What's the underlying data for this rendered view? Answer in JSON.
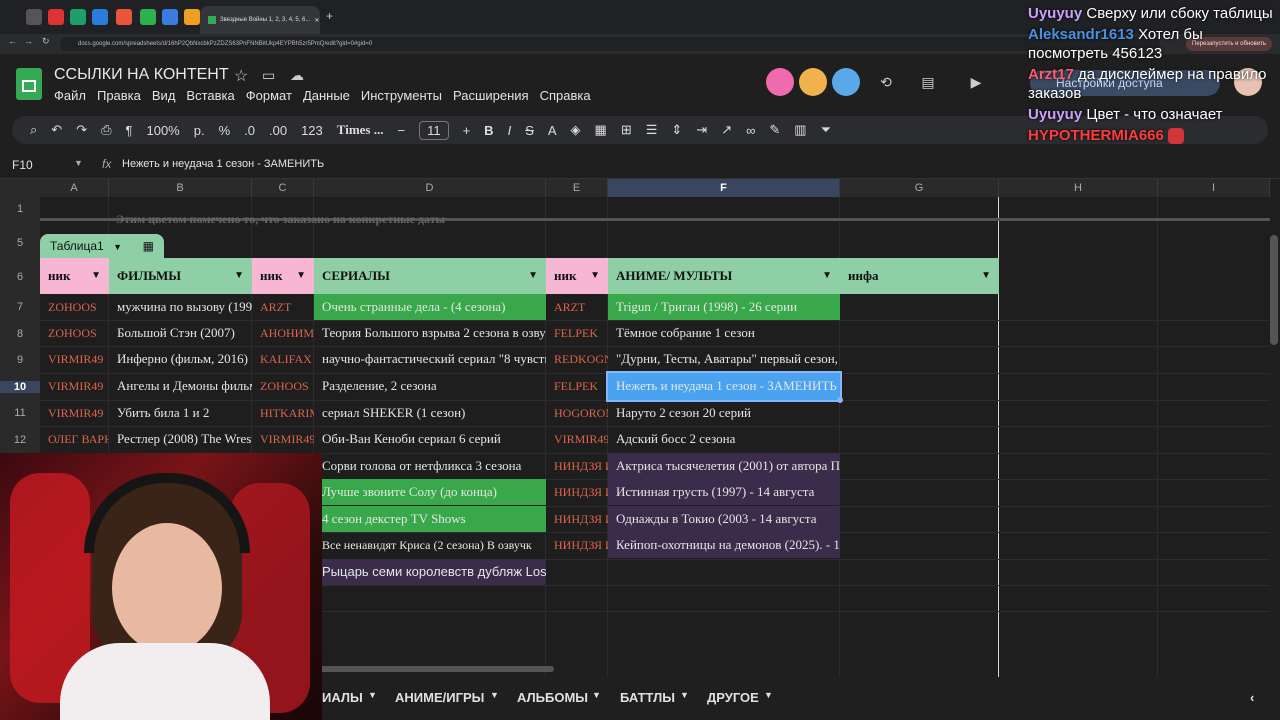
{
  "browser": {
    "active_tab_title": "Звездные Войны 1, 2, 3, 4, 5, 6...",
    "url": "docs.google.com/spreadsheets/d/16hP2QbNxcbkPzZDZS63PnFNNBitUkp4EYPBh5zr5PmQ/edit?gid=0#gid=0",
    "restart_label": "Перезапустить и обновить"
  },
  "doc": {
    "title": "ССЫЛКИ НА КОНТЕНТ",
    "menu": [
      "Файл",
      "Правка",
      "Вид",
      "Вставка",
      "Формат",
      "Данные",
      "Инструменты",
      "Расширения",
      "Справка"
    ],
    "access_button": "Настройки доступа"
  },
  "toolbar": {
    "zoom": "100%",
    "currency": "р.",
    "percent": "%",
    "dec_less": ".0",
    "dec_more": ".00",
    "format_123": "123",
    "font": "Times ...",
    "font_size": "11",
    "bold": "B",
    "italic": "I",
    "strike": "S",
    "text_color": "A"
  },
  "formula_bar": {
    "cell_ref": "F10",
    "fx": "fx",
    "content": "Нежеть и неудача 1 сезон - ЗАМЕНИТЬ"
  },
  "grid": {
    "columns": [
      "A",
      "B",
      "C",
      "D",
      "E",
      "F",
      "G",
      "H",
      "I"
    ],
    "rows": [
      "1",
      "5",
      "6",
      "7",
      "8",
      "9",
      "10",
      "11",
      "12"
    ],
    "note_row": "Этим цветом помечено то, что заказано на конкретные даты",
    "table_name": "Таблица1",
    "headers": {
      "nick1": "ник",
      "films": "ФИЛЬМЫ",
      "nick2": "ник",
      "series": "СЕРИАЛЫ",
      "nick3": "ник",
      "anime": "АНИМЕ/ МУЛЬТЫ",
      "info": "инфа"
    },
    "col_a": [
      "ZOHOOS",
      "ZOHOOS",
      "VIRMIR49",
      "VIRMIR49",
      "VIRMIR49",
      "ОЛЕГ ВАРНАВСКИ"
    ],
    "col_b": [
      "мужчина по вызову (1999",
      "Большой Стэн (2007)",
      "Инферно (фильм, 2016)",
      "Ангелы и Демоны фильм",
      "Убить била 1 и 2",
      "Рестлер (2008) The Wrest"
    ],
    "col_c": [
      "ARZT",
      "АНОНИМ",
      "KALIFAX",
      "ZOHOOS",
      "HITKARIM",
      "VIRMIR49"
    ],
    "col_d": [
      "Очень странные дела - (4 сезона)",
      "Теория Большого взрыва 2 сезона в озвуч",
      "научно-фантастический сериал \"8 чувств",
      "Разделение, 2 сезона",
      "сериал SHEKER (1 сезон)",
      "Оби-Ван Кеноби  сериал  6 серий",
      "Сорви голова от нетфликса 3 сезона",
      "Лучше звоните Солу (до конца)",
      "4 сезон декстер TV Shows",
      "Все ненавидят Криса (2 сезона) В озвучк",
      "Рыцарь семи королевств дубляж Lostfi"
    ],
    "col_e": [
      "ARZT",
      "FELPEK",
      "REDKOGNAR",
      "FELPEK",
      "HOGOROMO",
      "VIRMIR49",
      "НИНДЗЯ ИЗ А",
      "НИНДЗЯ ИЗ А",
      "НИНДЗЯ ИЗ А",
      "НИНДЗЯ ИЗ А"
    ],
    "col_f": [
      "Trigun / Триган (1998) - 26 серии",
      "Тёмное собрание 1 сезон",
      "\"Дурни, Тесты, Аватары\" первый сезон, т",
      "Нежеть и неудача 1 сезон - ЗАМЕНИТЬ",
      "Наруто 2 сезон 20 серий",
      "Адский босс 2 сезона",
      "Актриса тысячелетия (2001) от автора Па",
      "Истинная грусть (1997) - 14 августа",
      "Однажды в Токио (2003 - 14 августа",
      "Кейпоп-охотницы на демонов (2025). - 15"
    ]
  },
  "sheet_tabs": [
    "ИАЛЫ",
    "АНИМЕ/ИГРЫ",
    "АЛЬБОМЫ",
    "БАТТЛЫ",
    "ДРУГОЕ"
  ],
  "chat": [
    {
      "name": "Uyuyuy",
      "text": "Сверху или сбоку таблицы",
      "color": "#c9a0ff"
    },
    {
      "name": "Aleksandr1613",
      "text": "Хотел бы посмотреть 456123",
      "color": "#4a90e2"
    },
    {
      "name": "Arzt17",
      "text": "да дисклеймер на правило заказов",
      "color": "#ff5a6e"
    },
    {
      "name": "Uyuyuy",
      "text": "Цвет - что означает",
      "color": "#c9a0ff"
    },
    {
      "name": "HYPOTHERMIA666",
      "text": "",
      "color": "#ff3b3b"
    }
  ],
  "colors": {
    "pink_header": "#f7b7d4",
    "green_header": "#8fcfa6",
    "green_fill": "#38a84b",
    "selected_fill": "#4aa3f0",
    "purple_fill": "#3a2c4a"
  }
}
